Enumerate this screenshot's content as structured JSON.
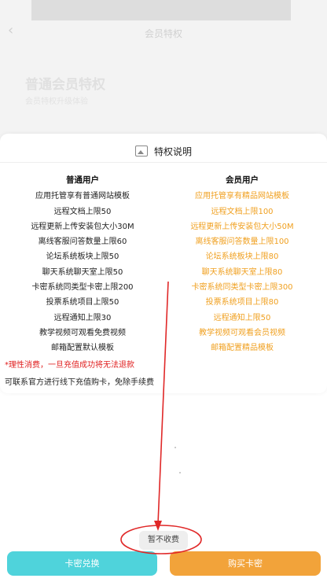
{
  "header": {
    "nav_title": "会员特权",
    "ghost_title": "普通会员特权",
    "ghost_subtitle": "会员特权升级体验"
  },
  "panel": {
    "title": "特权说明",
    "left_header": "普通用户",
    "right_header": "会员用户",
    "left_items": [
      "应用托管享有普通网站模板",
      "远程文档上限50",
      "远程更新上传安装包大小30M",
      "离线客服问答数量上限60",
      "论坛系统板块上限50",
      "聊天系统聊天室上限50",
      "卡密系统同类型卡密上限200",
      "投票系统项目上限50",
      "远程通知上限30",
      "教学视频可观看免费视频",
      "邮箱配置默认模板"
    ],
    "right_items": [
      "应用托管享有精品网站模板",
      "远程文档上限100",
      "远程更新上传安装包大小50M",
      "离线客服问答数量上限100",
      "论坛系统板块上限80",
      "聊天系统聊天室上限80",
      "卡密系统同类型卡密上限300",
      "投票系统项目上限80",
      "远程通知上限50",
      "教学视频可观看会员视频",
      "邮箱配置精品模板"
    ],
    "warning": "*理性消费，一旦充值成功将无法退款",
    "note": "可联系官方进行线下充值购卡，免除手续费"
  },
  "buttons": {
    "middle": "暂不收费",
    "left": "卡密兑换",
    "right": "购买卡密"
  },
  "colors": {
    "accent_orange": "#f0a020",
    "warning_red": "#e02020",
    "teal": "#4fd3db",
    "orange_button": "#f2a33a",
    "annotation_red": "#e02828"
  }
}
